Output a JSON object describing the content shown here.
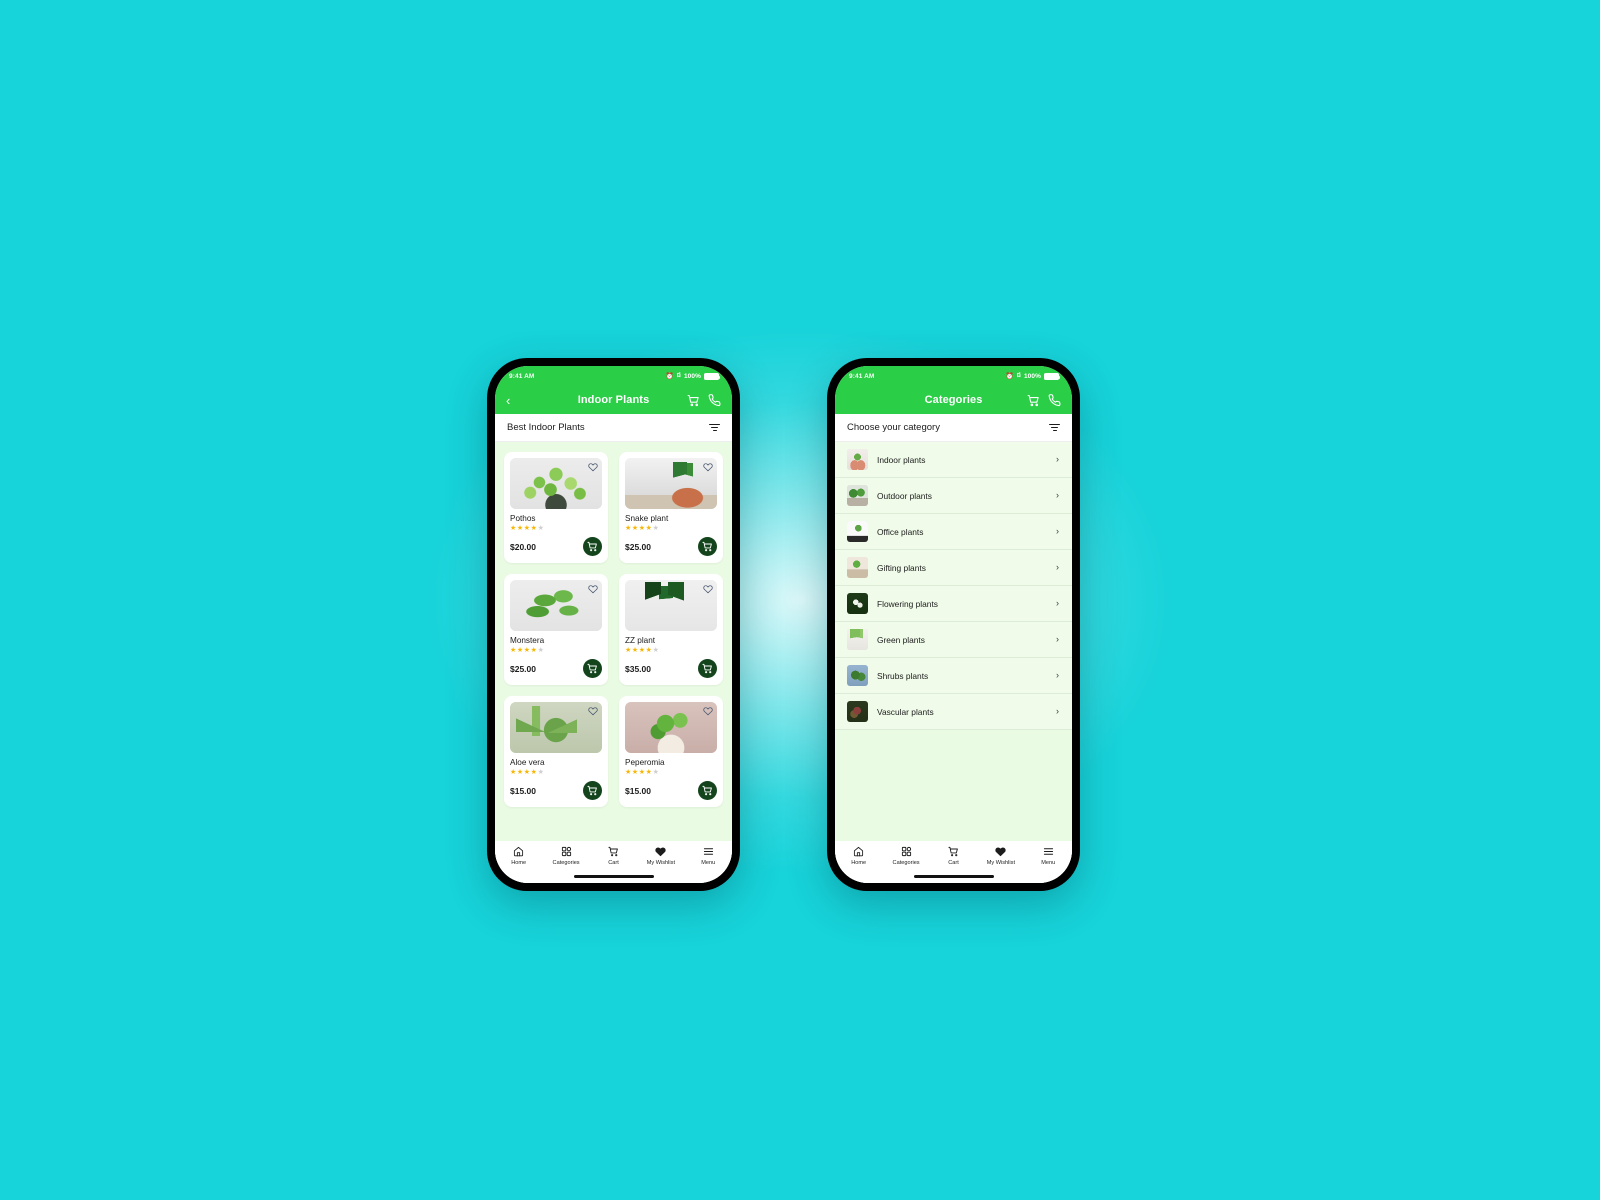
{
  "background": {
    "color": "#17d3da",
    "glow": "#ffffff"
  },
  "theme": {
    "brand_green": "#2bce47",
    "dark_green": "#13441c",
    "page_bg": "#eafbe4",
    "list_bg": "#f0fbea",
    "star_on": "#f5b80a",
    "star_off": "#cfcfcf"
  },
  "status_bar": {
    "time": "9:41 AM",
    "battery_percent": "100%",
    "icons": [
      "alarm-icon",
      "bluetooth-icon",
      "battery-icon"
    ]
  },
  "phones": [
    {
      "id": "indoor-plants",
      "header": {
        "title": "Indoor Plants",
        "back_label": "‹",
        "has_back": true,
        "actions": [
          "cart-icon",
          "phone-icon"
        ]
      },
      "section": {
        "label": "Best Indoor Plants",
        "filter_icon": "filter-icon"
      },
      "products": [
        {
          "name": "Pothos",
          "price": "$20.00",
          "rating": 4,
          "max_rating": 5,
          "art": "pothos",
          "wishlist": false
        },
        {
          "name": "Snake plant",
          "price": "$25.00",
          "rating": 4,
          "max_rating": 5,
          "art": "snake",
          "wishlist": false
        },
        {
          "name": "Monstera",
          "price": "$25.00",
          "rating": 4,
          "max_rating": 5,
          "art": "monstera",
          "wishlist": false
        },
        {
          "name": "ZZ plant",
          "price": "$35.00",
          "rating": 4,
          "max_rating": 5,
          "art": "zz",
          "wishlist": false
        },
        {
          "name": "Aloe vera",
          "price": "$15.00",
          "rating": 4,
          "max_rating": 5,
          "art": "aloe",
          "wishlist": false
        },
        {
          "name": "Peperomia",
          "price": "$15.00",
          "rating": 4,
          "max_rating": 5,
          "art": "peperomia",
          "wishlist": false
        }
      ]
    },
    {
      "id": "categories",
      "header": {
        "title": "Categories",
        "back_label": "",
        "has_back": false,
        "actions": [
          "cart-icon",
          "phone-icon"
        ]
      },
      "section": {
        "label": "Choose your category",
        "filter_icon": "filter-icon"
      },
      "categories": [
        {
          "label": "Indoor plants",
          "art": "cat-indoor",
          "chevron": "›"
        },
        {
          "label": "Outdoor plants",
          "art": "cat-outdoor",
          "chevron": "›"
        },
        {
          "label": "Office plants",
          "art": "cat-office",
          "chevron": "›"
        },
        {
          "label": "Gifting plants",
          "art": "cat-gifting",
          "chevron": "›"
        },
        {
          "label": "Flowering plants",
          "art": "cat-flower",
          "chevron": "›"
        },
        {
          "label": "Green plants",
          "art": "cat-green",
          "chevron": "›"
        },
        {
          "label": "Shrubs plants",
          "art": "cat-shrubs",
          "chevron": "›"
        },
        {
          "label": "Vascular plants",
          "art": "cat-vascular",
          "chevron": "›"
        }
      ]
    }
  ],
  "bottom_nav": [
    {
      "label": "Home",
      "icon": "home-icon"
    },
    {
      "label": "Categories",
      "icon": "grid-icon"
    },
    {
      "label": "Cart",
      "icon": "cart-icon"
    },
    {
      "label": "My Wishlist",
      "icon": "heart-icon"
    },
    {
      "label": "Menu",
      "icon": "hamburger-icon"
    }
  ]
}
